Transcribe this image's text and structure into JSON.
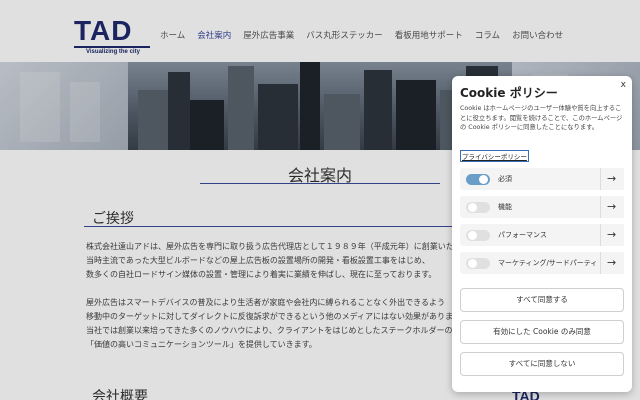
{
  "logo": {
    "text": "TAD",
    "tagline": "Visualizing the city"
  },
  "nav": [
    {
      "label": "ホーム"
    },
    {
      "label": "会社案内"
    },
    {
      "label": "屋外広告事業"
    },
    {
      "label": "バス丸形ステッカー"
    },
    {
      "label": "看板用地サポート"
    },
    {
      "label": "コラム"
    },
    {
      "label": "お問い合わせ"
    }
  ],
  "page": {
    "title": "会社案内",
    "section1": "ご挨拶",
    "greeting_lines": [
      "株式会社遠山アドは、屋外広告を専門に取り扱う広告代理店として１９８９年（平成元年）に創業いた",
      "当時主流であった大型ビルボードなどの屋上広告板の設置場所の開発・看板設置工事をはじめ、",
      "数多くの自社ロードサイン媒体の設置・管理により着実に業績を伸ばし、現在に至っております。"
    ],
    "ooh_lines": [
      "屋外広告はスマートデバイスの普及により生活者が家庭や会社内に縛られることなく外出できるよう",
      "移動中のターゲットに対してダイレクトに反復訴求ができるという他のメディアにはない効果がありま",
      "当社では創業以来培ってきた多くのノウハウにより、クライアントをはじめとしたステークホルダーの",
      "「価値の高いコミュニケーションツール」を提供していきます。"
    ],
    "section2": "会社概要",
    "tad_small": "TAD"
  },
  "cookie": {
    "title": "Cookie ポリシー",
    "close": "x",
    "description": "Cookie はホームページのユーザー体験や質を向上することに役立ちます。閲覧を続けることで、このホームページの Cookie ポリシーに同意したことになります。",
    "policy_link": "プライバシーポリシー",
    "categories": [
      {
        "label": "必須",
        "on": true
      },
      {
        "label": "機能",
        "on": false
      },
      {
        "label": "パフォーマンス",
        "on": false
      },
      {
        "label": "マーケティング/サードパーティ",
        "on": false
      }
    ],
    "buttons": {
      "accept_all": "すべて同意する",
      "accept_enabled": "有効にした Cookie のみ同意",
      "reject_all": "すべてに同意しない"
    }
  },
  "colors": {
    "brand": "#1f2a6b",
    "accent": "#3b4a9c",
    "toggle_on": "#6a9ec8"
  }
}
